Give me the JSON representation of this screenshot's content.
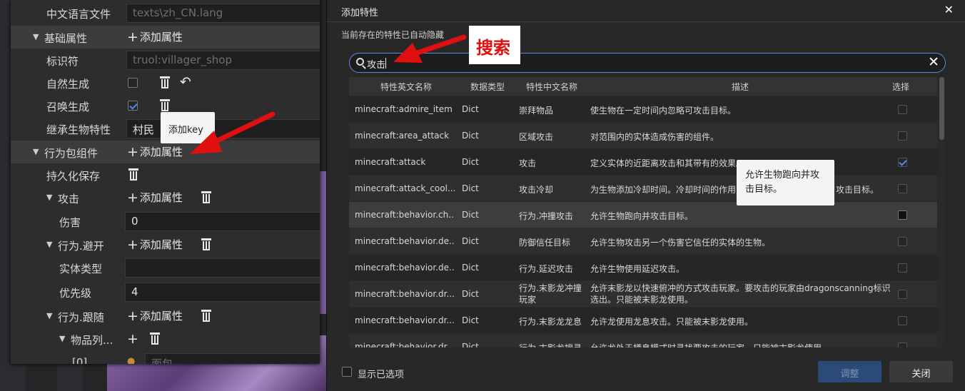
{
  "left_panel": {
    "rows": [
      {
        "label": "中文语言文件",
        "value": "texts\\zh_CN.lang"
      },
      {
        "label": "基础属性",
        "add": "添加属性"
      },
      {
        "label": "标识符",
        "value": "truol:villager_shop"
      },
      {
        "label": "自然生成"
      },
      {
        "label": "召唤生成"
      },
      {
        "label": "继承生物特性",
        "value": "村民"
      },
      {
        "label": "行为包组件",
        "add": "添加属性"
      },
      {
        "label": "持久化保存"
      },
      {
        "label": "攻击",
        "add": "添加属性"
      },
      {
        "label": "伤害",
        "value": "0"
      },
      {
        "label": "行为.避开",
        "add": "添加属性"
      },
      {
        "label": "实体类型",
        "value": ""
      },
      {
        "label": "优先级",
        "value": "4"
      },
      {
        "label": "行为.跟随",
        "add": "添加属性"
      },
      {
        "label": "物品列..."
      },
      {
        "label": "[0]",
        "value": "面包"
      }
    ],
    "tooltip": "添加key",
    "checkbox_states": {
      "natural_spawn": false,
      "summon_spawn": true
    }
  },
  "dialog": {
    "title": "添加特性",
    "close_icon": "close-icon",
    "hint": "当前存在的特性已自动隐藏",
    "callout": "搜索",
    "search": {
      "value": "攻击"
    },
    "columns": [
      "特性英文名称",
      "数据类型",
      "特性中文名称",
      "描述",
      "选择"
    ],
    "rows": [
      {
        "name": "minecraft:admire_item",
        "type": "Dict",
        "cn": "崇拜物品",
        "desc": "使生物在一定时间内忽略可攻击目标。",
        "checked": false
      },
      {
        "name": "minecraft:area_attack",
        "type": "Dict",
        "cn": "区域攻击",
        "desc": "对范围内的实体造成伤害的组件。",
        "checked": false
      },
      {
        "name": "minecraft:attack",
        "type": "Dict",
        "cn": "攻击",
        "desc": "定义实体的近距离攻击和其带有的效果。",
        "checked": true
      },
      {
        "name": "minecraft:attack_cool...",
        "type": "Dict",
        "cn": "攻击冷却",
        "desc": "为生物添加冷却时间。冷却时间的作用",
        "desc_end": "攻击目标。",
        "checked": false
      },
      {
        "name": "minecraft:behavior.ch...",
        "type": "Dict",
        "cn": "行为.冲撞攻击",
        "desc": "允许生物跑向并攻击目标。",
        "checked": false,
        "hover": true
      },
      {
        "name": "minecraft:behavior.de...",
        "type": "Dict",
        "cn": "防御信任目标",
        "desc": "允许生物攻击另一个伤害它信任的实体的生物。",
        "checked": false
      },
      {
        "name": "minecraft:behavior.de...",
        "type": "Dict",
        "cn": "行为.延迟攻击",
        "desc": "允许生物使用延迟攻击。",
        "checked": false
      },
      {
        "name": "minecraft:behavior.dr...",
        "type": "Dict",
        "cn": "行为.末影龙冲撞玩家",
        "desc": "允许末影龙以快速俯冲的方式攻击玩家。要攻击的玩家由dragonscanning标识选出。只能被末影龙使用。",
        "checked": false
      },
      {
        "name": "minecraft:behavior.dr...",
        "type": "Dict",
        "cn": "行为.末影龙龙息",
        "desc": "允许龙使用龙息攻击。只能被末影龙使用。",
        "checked": false
      },
      {
        "name": "minecraft:behavior.dr...",
        "type": "Dict",
        "cn": "行为.末影龙搜寻",
        "desc": "允许龙处于栖息模式时寻找要攻击的玩家。只能被末影龙使用。",
        "checked": false
      }
    ],
    "tooltip": "允许生物跑向并攻击目标。",
    "show_selected": "显示已选项",
    "adjust_button": "调整",
    "close_button": "关闭"
  },
  "colors": {
    "accent": "#5b8de0",
    "arrow": "#e01010",
    "primary_button": "#2b4a78"
  }
}
